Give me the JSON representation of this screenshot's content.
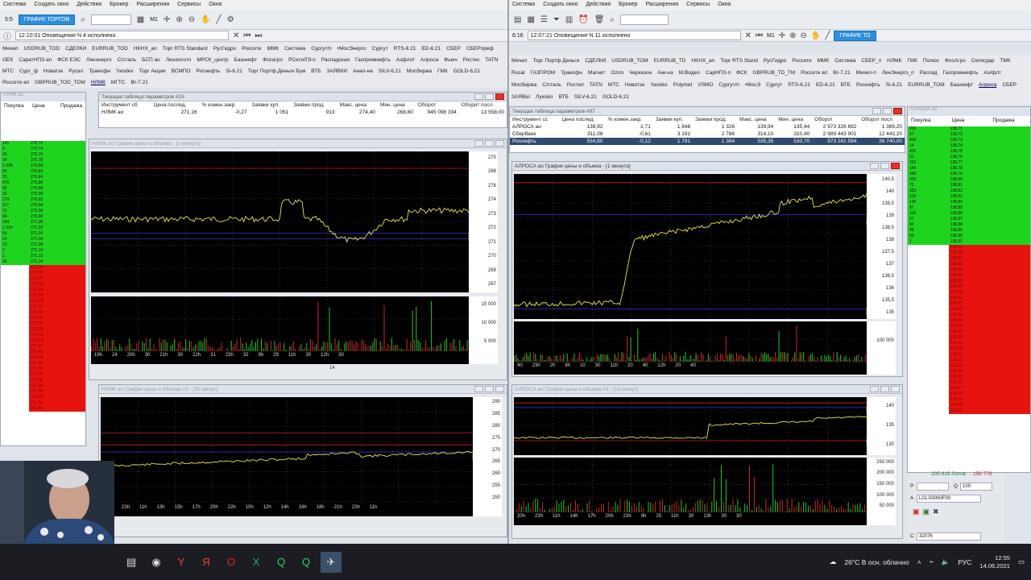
{
  "left": {
    "menu": [
      "Система",
      "Создать окно",
      "Действия",
      "Брокер",
      "Расширения",
      "Сервисы",
      "Окна"
    ],
    "trade_button": "ГРАФИК ТОРГОВ",
    "session": "5:5",
    "timeframe": "M1",
    "notification": "12:10:01 Оповещение N 4 исполнено.",
    "tabs": [
      "Мечел",
      "USDRUB_TOD",
      "СДЕЛКИ",
      "EURRUB_TOD",
      "HKHX_an",
      "Торг RTS Standard",
      "РусГидро",
      "Россети",
      "ММК",
      "Система",
      "Сургут/п",
      "•МосЭнерго",
      "Сургут",
      "RTS-6.21",
      "ED-6.21",
      "СБЕР",
      "СБЕРпреф",
      "ОЕК",
      "СаратНПЗ-ап",
      "ФСК ЕЭС",
      "Ленэнерго",
      "С/сталь",
      "БСП ао",
      "Лензолото",
      "МРСК_центр",
      "Башнефт",
      "Фосагро",
      "РСетиЛЭ-п",
      "Распадская",
      "Газпромнефть",
      "Аэфлот",
      "Алроса",
      "Фьюч",
      "Ростех",
      "TATN",
      "МТС",
      "Сург_ф",
      "Новатэк",
      "Русал",
      "Трансфн",
      "Yandex",
      "Торг Акции",
      "ВСМПО",
      "Роснефть",
      "Si-6.21",
      "Торг Портф Деньги Бум",
      "ВТБ",
      "ЗАЯВКИ",
      "Анал-на",
      "SILV-6.21",
      "Мосбиржа",
      "ГМК",
      "GOLD-6.21",
      "Россети ап",
      "GBPRUB_TOD_TOM",
      "НЛМК",
      "МГТС",
      "Br-7.21"
    ],
    "active_tab": "НЛМК",
    "dom_header": [
      "Покупка",
      "Цена",
      "Продажа"
    ],
    "dom_buy": [
      [
        "141",
        "270,72"
      ],
      [
        "4",
        "270,74"
      ],
      [
        "35",
        "270,76"
      ],
      [
        "14",
        "270,78"
      ],
      [
        "1 028",
        "270,80"
      ],
      [
        "26",
        "270,82"
      ],
      [
        "15",
        "270,84"
      ],
      [
        "470",
        "270,86"
      ],
      [
        "92",
        "270,88"
      ],
      [
        "33",
        "270,90"
      ],
      [
        "279",
        "270,92"
      ],
      [
        "117",
        "270,94"
      ],
      [
        "72",
        "270,96"
      ],
      [
        "64",
        "270,98"
      ],
      [
        "244",
        "271,00"
      ],
      [
        "1 324",
        "271,02"
      ],
      [
        "54",
        "271,04"
      ],
      [
        "24",
        "271,06"
      ],
      [
        "13",
        "271,08"
      ],
      [
        "3",
        "271,10"
      ],
      [
        "1",
        "271,12"
      ],
      [
        "35",
        "271,14"
      ]
    ],
    "dom_sell": [
      "271,16",
      "271,18",
      "271,20",
      "271,22",
      "271,24",
      "271,26",
      "271,28",
      "271,30",
      "271,32",
      "271,34",
      "271,36",
      "271,38",
      "271,40",
      "271,42",
      "271,44",
      "271,46",
      "271,48",
      "271,50",
      "271,52",
      "271,54",
      "271,56",
      "271,58",
      "271,60",
      "271,62",
      "271,64",
      "271,66"
    ],
    "param_title": "Текущая таблица параметров #15",
    "param_header": [
      "Инструмент сб",
      "Цена послед.",
      "% измен.закр.",
      "Заявки куп.",
      "Заявки прод.",
      "Макс. цена",
      "Мин. цена",
      "Оборот",
      "Оборот посл."
    ],
    "param_row": [
      "НЛМК ао",
      "271,16",
      "-0,27",
      "1 051",
      "913",
      "274,40",
      "268,80",
      "945 098 334",
      "13 558,00"
    ],
    "chart1_title": "НЛМК ао График цены и объема - [1 минута]",
    "chart1_yticks": [
      "270",
      "268",
      "276",
      "274",
      "273",
      "272",
      "271",
      "270",
      "269",
      "267"
    ],
    "chart1_last": "271,16",
    "chart1_vol": [
      "15 000",
      "10 000",
      "5 000"
    ],
    "chart1_x": [
      "19h",
      "24",
      "20h",
      "30",
      "21h",
      "30",
      "22h",
      "31",
      "23h",
      "32",
      "9h",
      "29",
      "11h",
      "30",
      "12h",
      "30"
    ],
    "chart1_date": "14",
    "chart2_title": "НЛМК ао График цены и объема #3 - [30 минут]",
    "chart2_yticks": [
      "290",
      "285",
      "280",
      "275",
      "270",
      "265",
      "260",
      "255",
      "250"
    ],
    "chart2_last": "271,16",
    "chart2_x": [
      "21h",
      "23h",
      "11h",
      "13h",
      "15h",
      "17h",
      "20h",
      "22h",
      "10h",
      "12h",
      "14h",
      "16h",
      "18h",
      "21h",
      "23h",
      "11h"
    ],
    "chart2_dates": [
      "10",
      "11",
      "14"
    ]
  },
  "right": {
    "menu": [
      "Система",
      "Создать окно",
      "Действия",
      "Брокер",
      "Расширения",
      "Сервисы",
      "Окна"
    ],
    "trade_button": "ГРАФИК ТО",
    "session": "6:16",
    "timeframe": "M1",
    "notification": "12:07:21 Оповещение N 11 исполнено",
    "tabs": [
      "Мечел",
      "Торг Портф Деньги",
      "СДЕЛКИ",
      "USDRUB_TOM",
      "EURRUB_TD",
      "HKHX_an",
      "Торг RTS Stand",
      "РусГидро",
      "Россети",
      "ММК",
      "Система",
      "СБЕР_п",
      "НЛМК",
      "ГМК",
      "Полюс",
      "ФосАгро",
      "Селигдар",
      "ТМК",
      "Rusal",
      "ГАЗПРОМ",
      "Трансфн",
      "Магнит",
      "Ozon",
      "Черкизон",
      "Анк-ка",
      "М.Видео",
      "СарНПЗ-п",
      "ФСК",
      "GBPRUB_TD_TM",
      "Россети ап",
      "Вr-7.21",
      "Мечел-п",
      "ЛенЭнерго_п",
      "Распад",
      "Газпромнефть",
      "Аэ/флт",
      "Мосбиржа",
      "С/сталь",
      "Ростел",
      "TATN",
      "МТС",
      "Новотэк",
      "Yandex",
      "Polymet",
      "VSMO",
      "Сургут/п",
      "•МосЭ",
      "Сургут",
      "RTS-6.21",
      "ED-6.21",
      "ВТБ",
      "Роснефть",
      "Si-6.21",
      "EURRUB_TOM",
      "Башнефт",
      "Алроса",
      "СБЕР",
      "ЗАЯВЫ",
      "Лукойл",
      "ВТБ",
      "SILV-6.21",
      "GOLD-6.21"
    ],
    "active_tab": "Алроса",
    "param_title": "Текущая таблица параметров #87",
    "param_header": [
      "Инструмент сс",
      "Цена послед.",
      "% измен.закр.",
      "Заявки куп.",
      "Заявки прод.",
      "Макс. цена",
      "Мин. цена",
      "Оборот",
      "Оборот посл."
    ],
    "param_rows": [
      [
        "АЛРОСА ао",
        "138,92",
        "2,71",
        "1 848",
        "1 326",
        "139,94",
        "135,44",
        "2 973 328 692",
        "1 389,20"
      ],
      [
        "Сбербанк",
        "311,08",
        "-0,61",
        "3 191",
        "2 788",
        "314,10",
        "310,40",
        "2 989 443 901",
        "12 443,20"
      ],
      [
        "Роснефть",
        "534,80",
        "-0,12",
        "1 781",
        "1 364",
        "535,35",
        "530,70",
        "973 241 594",
        "26 740,00"
      ]
    ],
    "chart1_title": "АЛРОСА ао График цены и объема - [1 минута]",
    "chart1_yticks": [
      "140,5",
      "140",
      "139,5",
      "139",
      "138,5",
      "138",
      "137,5",
      "137",
      "136,5",
      "136",
      "135,5",
      "135"
    ],
    "chart1_last": "138,92",
    "chart1_low": "134,54",
    "chart1_vol": [
      "100 000"
    ],
    "chart1_x": [
      "40",
      "23h",
      "20",
      "9h",
      "10",
      "30",
      "11h",
      "20",
      "40",
      "12h",
      "20",
      "40"
    ],
    "chart1_date": "14",
    "chart2_title": "АЛРОСА ао График цены и объема #2 - [15 минут]",
    "chart2_yticks": [
      "140",
      "135",
      "130"
    ],
    "chart2_last": "138,92",
    "chart2_low": "134,54",
    "chart2_vol": [
      "250 000",
      "200 000",
      "150 000",
      "100 000",
      "50 000"
    ],
    "chart2_x": [
      "20h",
      "23h",
      "11h",
      "14h",
      "17h",
      "20h",
      "23h",
      "9h",
      "25",
      "11h",
      "30",
      "13h",
      "30",
      "30"
    ],
    "chart2_date": "14",
    "dom_header": [
      "Покупка",
      "Цена",
      "Продажа"
    ],
    "dom_buy": [
      [
        "226",
        "138,71"
      ],
      [
        "37",
        "138,72"
      ],
      [
        "400",
        "138,73"
      ],
      [
        "14",
        "138,74"
      ],
      [
        "422",
        "138,75"
      ],
      [
        "31",
        "138,76"
      ],
      [
        "332",
        "138,77"
      ],
      [
        "149",
        "138,78"
      ],
      [
        "350",
        "138,79"
      ],
      [
        "325",
        "138,80"
      ],
      [
        "72",
        "138,81"
      ],
      [
        "353",
        "138,82"
      ],
      [
        "210",
        "138,83"
      ],
      [
        "135",
        "138,84"
      ],
      [
        "97",
        "138,85"
      ],
      [
        "118",
        "138,86"
      ],
      [
        "27",
        "138,87"
      ],
      [
        "86",
        "138,88"
      ],
      [
        "46",
        "138,89"
      ],
      [
        "50",
        "138,90"
      ],
      [
        "1",
        "138,91"
      ]
    ],
    "dom_sell": [
      "138,92",
      "138,93",
      "138,94",
      "138,95",
      "138,96",
      "138,97",
      "138,98",
      "138,99",
      "139,00",
      "139,01",
      "139,02",
      "139,03",
      "139,04",
      "139,05",
      "139,06",
      "139,07",
      "139,08",
      "139,09",
      "139,10",
      "139,11",
      "139,12",
      "139,13",
      "139,14",
      "139,15",
      "139,16",
      "139,17",
      "139,18",
      "139,19",
      "139,20",
      "139,21"
    ],
    "order_summary_lots": "205 818 Лотов",
    "order_summary_value": "156 778",
    "order_price_label": "P",
    "order_qty_label": "Q",
    "order_qty": "100",
    "order_account_label": "A",
    "order_account": "L01-00000F00",
    "order_client_label": "C",
    "order_client": "32076"
  },
  "taskbar": {
    "weather": "26°C  В осн. облачно",
    "lang": "РУС",
    "time": "12:55",
    "date": "14.06.2021"
  },
  "colors": {
    "bid": "#1fd41f",
    "ask": "#e6130f",
    "price": "#e6e65a",
    "panel": "#dfe3ea",
    "accent": "#2d8fdc"
  }
}
